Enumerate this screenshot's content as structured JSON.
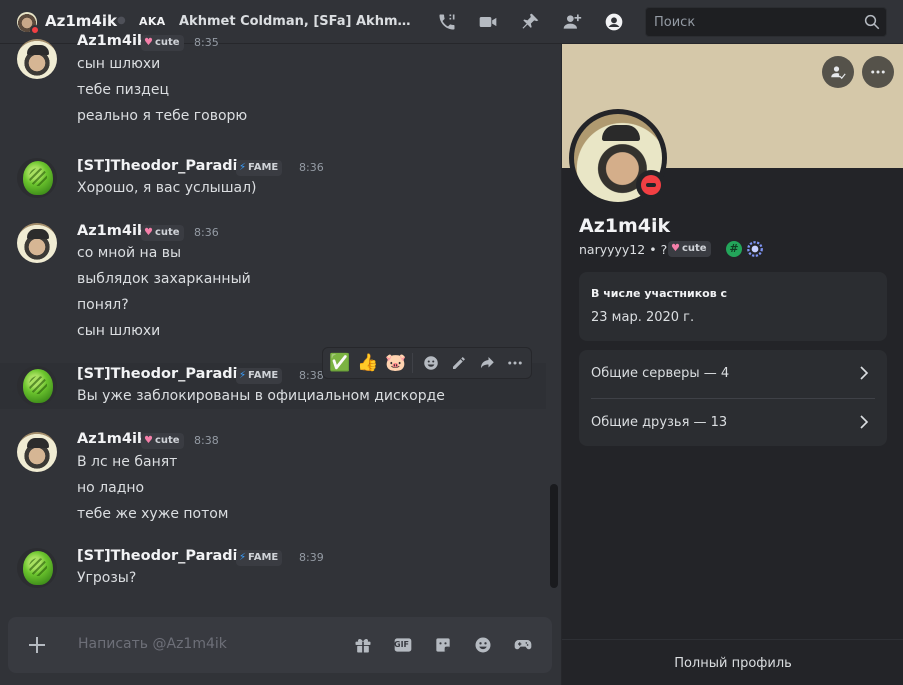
{
  "header": {
    "dm_name": "Az1m4ik",
    "aka_label": "AKA",
    "aliases": "Akhmet Coldman, [SFa] Akhmet_Coldman",
    "search_placeholder": "Поиск",
    "icons": [
      "phone-call-icon",
      "video-call-icon",
      "pin-icon",
      "add-friend-icon",
      "user-profile-icon",
      "search-icon"
    ]
  },
  "badges": {
    "cute": {
      "glyph": "♥",
      "label": "cute"
    },
    "fame": {
      "glyph": "⚡",
      "label": "FAME"
    }
  },
  "messages": [
    {
      "author": "Az1m4ik",
      "badge": "cute",
      "time": "8:35",
      "lines": [
        "сын шлюхи",
        "тебе пиздец",
        "реально я тебе говорю"
      ]
    },
    {
      "author": "[ST]Theodor_Paradise",
      "badge": "FAME",
      "time": "8:36",
      "lines": [
        "Хорошо, я вас услышал)"
      ]
    },
    {
      "author": "Az1m4ik",
      "badge": "cute",
      "time": "8:36",
      "lines": [
        "со мной на вы",
        "выблядок захарканный",
        "понял?",
        "сын шлюхи"
      ]
    },
    {
      "author": "[ST]Theodor_Paradise",
      "badge": "FAME",
      "time": "8:38",
      "lines": [
        "Вы уже заблокированы в официальном дискорде"
      ]
    },
    {
      "author": "Az1m4ik",
      "badge": "cute",
      "time": "8:38",
      "lines": [
        "В лс не банят",
        "но ладно",
        "тебе же хуже потом"
      ]
    },
    {
      "author": "[ST]Theodor_Paradise",
      "badge": "FAME",
      "time": "8:39",
      "lines": [
        "Угрозы?"
      ]
    }
  ],
  "hover_toolbar": {
    "reactions": [
      "✅",
      "👍",
      "🐷"
    ],
    "icons": [
      "add-reaction-icon",
      "edit-icon",
      "forward-icon",
      "more-icon"
    ]
  },
  "composer": {
    "placeholder": "Написать @Az1m4ik",
    "icons": [
      "add-attachment-icon",
      "gift-icon",
      "gif-icon",
      "sticker-icon",
      "emoji-icon",
      "activities-icon"
    ],
    "gif_label": "GIF"
  },
  "profile": {
    "name": "Az1m4ik",
    "handle": "naryyyy12",
    "separator": "•",
    "pronoun": "?",
    "member_since_title": "В числе участников с",
    "member_since": "23 мар. 2020 г.",
    "mutual_servers": "Общие серверы — 4",
    "mutual_friends": "Общие друзья — 13",
    "footer": "Полный профиль",
    "banner_color": "#d5c8a9",
    "status": "dnd"
  }
}
